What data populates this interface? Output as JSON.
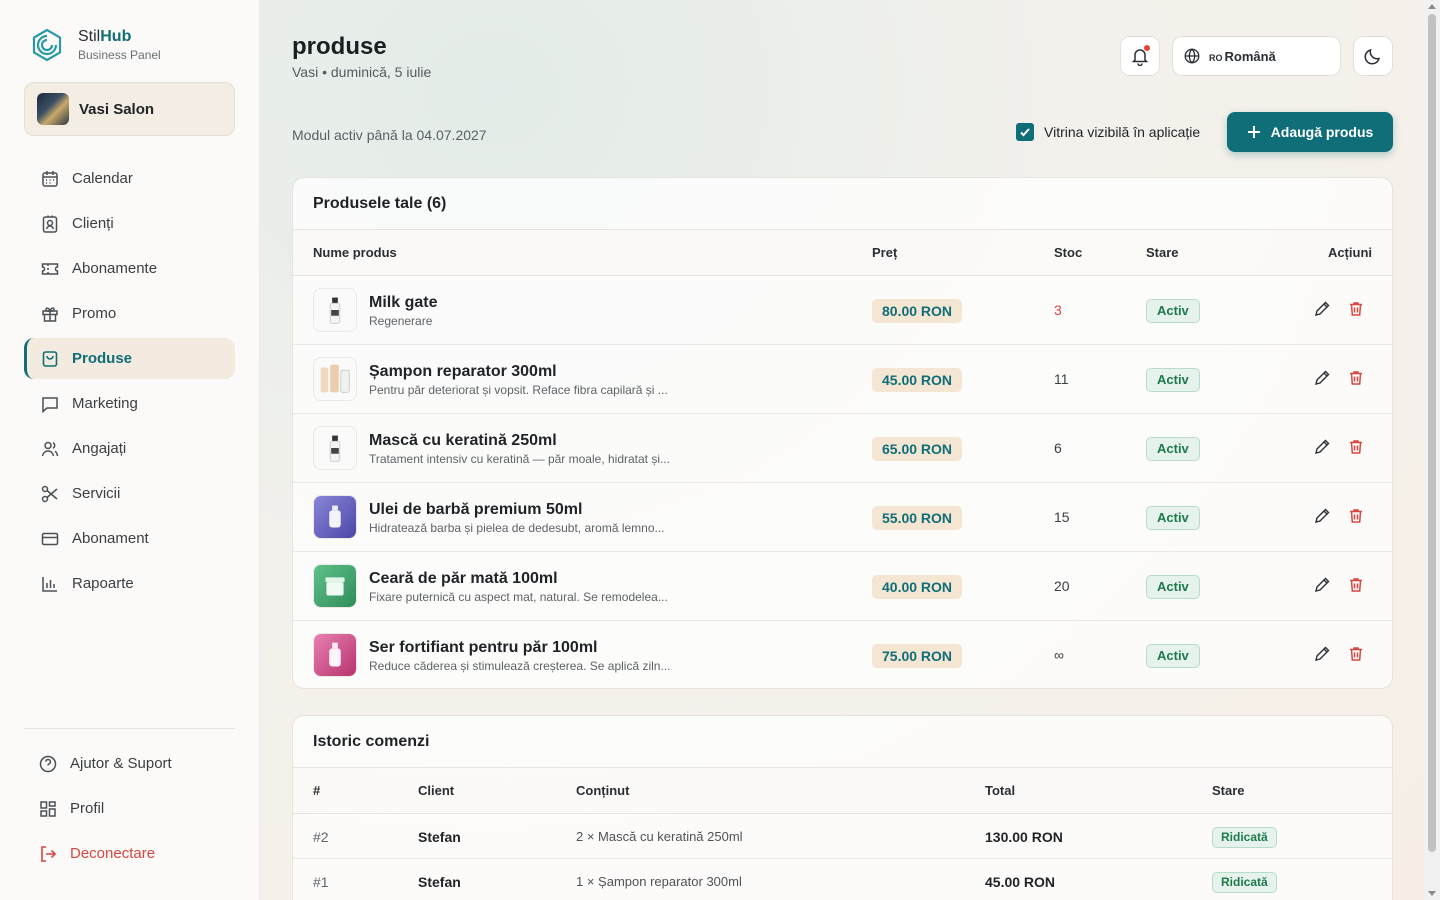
{
  "brand": {
    "name_plain": "Stil",
    "name_bold": "Hub",
    "subtitle": "Business Panel",
    "accent": "#0f6e78"
  },
  "salon": {
    "name": "Vasi Salon"
  },
  "nav": {
    "items": [
      {
        "label": "Calendar",
        "icon": "calendar-icon"
      },
      {
        "label": "Clienți",
        "icon": "contact-icon"
      },
      {
        "label": "Abonamente",
        "icon": "ticket-icon"
      },
      {
        "label": "Promo",
        "icon": "gift-icon"
      },
      {
        "label": "Produse",
        "icon": "bag-icon",
        "active": true
      },
      {
        "label": "Marketing",
        "icon": "message-icon"
      },
      {
        "label": "Angajați",
        "icon": "users-icon"
      },
      {
        "label": "Servicii",
        "icon": "scissors-icon"
      },
      {
        "label": "Abonament",
        "icon": "card-icon"
      },
      {
        "label": "Rapoarte",
        "icon": "chart-icon"
      }
    ],
    "bottom": [
      {
        "label": "Ajutor & Suport",
        "icon": "help-icon"
      },
      {
        "label": "Profil",
        "icon": "grid-icon"
      },
      {
        "label": "Deconectare",
        "icon": "logout-icon"
      }
    ]
  },
  "header": {
    "title": "produse",
    "subtitle": "Vasi • duminică, 5 iulie",
    "lang_code": "RO",
    "lang_label": "Română",
    "module_note": "Modul activ până la 04.07.2027",
    "visibility_label": "Vitrina vizibilă în aplicație",
    "visibility_checked": true,
    "add_button": "Adaugă produs"
  },
  "products": {
    "title": "Produsele tale (6)",
    "columns": {
      "name": "Nume produs",
      "price": "Preț",
      "stock": "Stoc",
      "status": "Stare",
      "actions": "Acțiuni"
    },
    "rows": [
      {
        "name": "Milk gate",
        "desc": "Regenerare",
        "price": "80.00 RON",
        "stock": "3",
        "low": true,
        "status": "Activ",
        "thumb": "bottle-white"
      },
      {
        "name": "Șampon reparator 300ml",
        "desc": "Pentru păr deteriorat și vopsit. Reface fibra capilară și ...",
        "price": "45.00 RON",
        "stock": "11",
        "status": "Activ",
        "thumb": "bottles-set"
      },
      {
        "name": "Mască cu keratină 250ml",
        "desc": "Tratament intensiv cu keratină — păr moale, hidratat și...",
        "price": "65.00 RON",
        "stock": "6",
        "status": "Activ",
        "thumb": "bottle-white"
      },
      {
        "name": "Ulei de barbă premium 50ml",
        "desc": "Hidratează barba și pielea de dedesubt, aromă lemno...",
        "price": "55.00 RON",
        "stock": "15",
        "status": "Activ",
        "thumb": "bottle-purple"
      },
      {
        "name": "Ceară de păr mată 100ml",
        "desc": "Fixare puternică cu aspect mat, natural. Se remodelea...",
        "price": "40.00 RON",
        "stock": "20",
        "status": "Activ",
        "thumb": "jar-green"
      },
      {
        "name": "Ser fortifiant pentru păr 100ml",
        "desc": "Reduce căderea și stimulează creșterea. Se aplică ziln...",
        "price": "75.00 RON",
        "stock": "∞",
        "status": "Activ",
        "thumb": "bottle-pink"
      }
    ]
  },
  "orders": {
    "title": "Istoric comenzi",
    "columns": {
      "id": "#",
      "client": "Client",
      "content": "Conținut",
      "total": "Total",
      "status": "Stare"
    },
    "rows": [
      {
        "id": "#2",
        "client": "Stefan",
        "content": "2 × Mască cu keratină 250ml",
        "total": "130.00 RON",
        "status": "Ridicată"
      },
      {
        "id": "#1",
        "client": "Stefan",
        "content": "1 × Șampon reparator 300ml",
        "total": "45.00 RON",
        "status": "Ridicată"
      }
    ]
  }
}
